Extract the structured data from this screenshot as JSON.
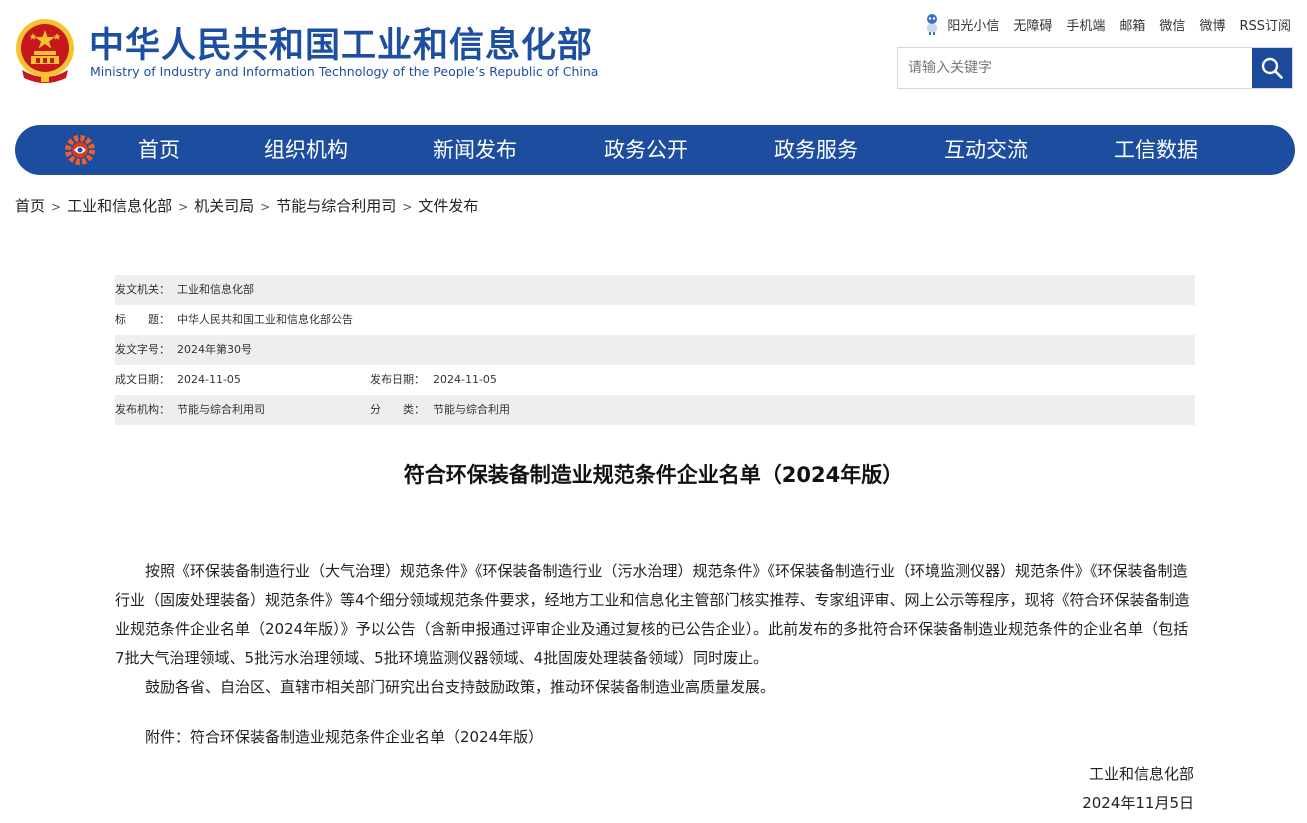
{
  "header": {
    "title_cn": "中华人民共和国工业和信息化部",
    "title_en": "Ministry of Industry and Information Technology of the People’s Republic of China",
    "top_links": [
      "阳光小信",
      "无障碍",
      "手机端",
      "邮箱",
      "微信",
      "微博",
      "RSS订阅"
    ],
    "search_placeholder": "请输入关键字",
    "colors": {
      "brand_blue": "#1d4d9e",
      "emblem_red": "#c8161d",
      "emblem_gold": "#f4c430"
    }
  },
  "nav": {
    "items": [
      "首页",
      "组织机构",
      "新闻发布",
      "政务公开",
      "政务服务",
      "互动交流",
      "工信数据"
    ]
  },
  "breadcrumb": [
    "首页",
    "工业和信息化部",
    "机关司局",
    "节能与综合利用司",
    "文件发布"
  ],
  "meta": {
    "issuer_label": "发文机关：",
    "issuer": "工业和信息化部",
    "title_label": "标　　题：",
    "title": "中华人民共和国工业和信息化部公告",
    "doc_no_label": "发文字号：",
    "doc_no": "2024年第30号",
    "created_label": "成文日期：",
    "created": "2024-11-05",
    "published_label": "发布日期：",
    "published": "2024-11-05",
    "org_label": "发布机构：",
    "org": "节能与综合利用司",
    "category_label": "分　　类：",
    "category": "节能与综合利用"
  },
  "document": {
    "title": "符合环保装备制造业规范条件企业名单（2024年版）",
    "paragraphs": [
      "按照《环保装备制造行业（大气治理）规范条件》《环保装备制造行业（污水治理）规范条件》《环保装备制造行业（环境监测仪器）规范条件》《环保装备制造行业（固废处理装备）规范条件》等4个细分领域规范条件要求，经地方工业和信息化主管部门核实推荐、专家组评审、网上公示等程序，现将《符合环保装备制造业规范条件企业名单（2024年版）》予以公告（含新申报通过评审企业及通过复核的已公告企业）。此前发布的多批符合环保装备制造业规范条件的企业名单（包括7批大气治理领域、5批污水治理领域、5批环境监测仪器领域、4批固废处理装备领域）同时废止。",
      "鼓励各省、自治区、直辖市相关部门研究出台支持鼓励政策，推动环保装备制造业高质量发展。"
    ],
    "attachment": "附件：符合环保装备制造业规范条件企业名单（2024年版）",
    "signature_org": "工业和信息化部",
    "signature_date": "2024年11月5日"
  }
}
